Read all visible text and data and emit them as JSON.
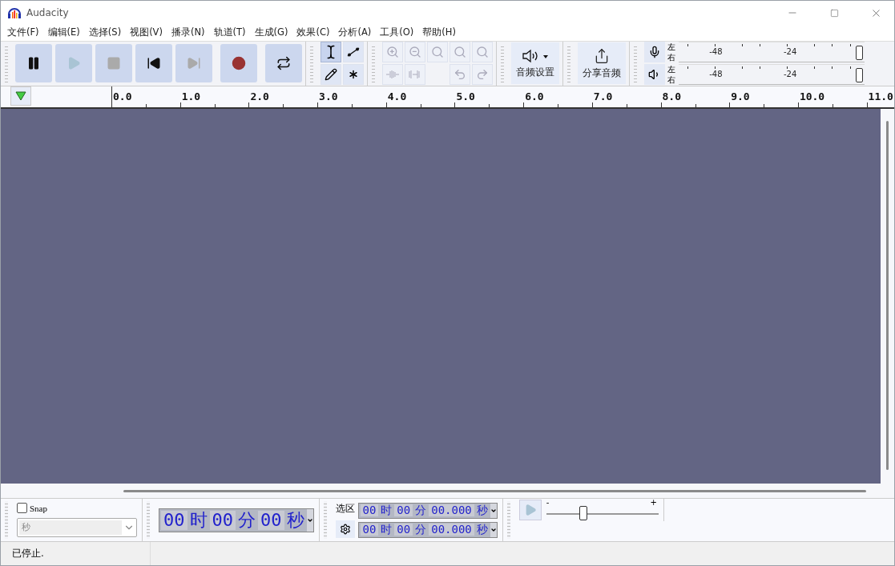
{
  "window": {
    "title": "Audacity"
  },
  "menu": [
    "文件(F)",
    "编辑(E)",
    "选择(S)",
    "视图(V)",
    "播录(N)",
    "轨道(T)",
    "生成(G)",
    "效果(C)",
    "分析(A)",
    "工具(O)",
    "帮助(H)"
  ],
  "transport": [
    {
      "kind": "pause",
      "disabled": false
    },
    {
      "kind": "play",
      "disabled": true
    },
    {
      "kind": "stop",
      "disabled": true
    },
    {
      "kind": "skip-start",
      "disabled": false
    },
    {
      "kind": "skip-end",
      "disabled": true
    },
    {
      "kind": "record",
      "disabled": false
    },
    {
      "kind": "loop",
      "disabled": false
    }
  ],
  "tools": [
    {
      "kind": "select",
      "selected": true
    },
    {
      "kind": "envelope",
      "selected": false
    },
    {
      "kind": "draw",
      "selected": false
    },
    {
      "kind": "multi",
      "selected": false
    }
  ],
  "edit_tools": [
    {
      "kind": "zoom-in",
      "disabled": true
    },
    {
      "kind": "zoom-out",
      "disabled": true
    },
    {
      "kind": "fit-selection",
      "disabled": true
    },
    {
      "kind": "fit-project",
      "disabled": true
    },
    {
      "kind": "zoom-toggle",
      "disabled": true
    },
    {
      "kind": "trim",
      "disabled": true
    },
    {
      "kind": "silence",
      "disabled": true
    },
    {
      "kind": "blank"
    },
    {
      "kind": "undo",
      "disabled": true
    },
    {
      "kind": "redo",
      "disabled": true
    }
  ],
  "audio_setup": {
    "label": "音频设置"
  },
  "share_audio": {
    "label": "分享音频"
  },
  "meters": [
    {
      "kind": "record",
      "channels": [
        "左",
        "右"
      ],
      "scale": [
        "-48",
        "-24"
      ],
      "level": 1
    },
    {
      "kind": "playback",
      "channels": [
        "左",
        "右"
      ],
      "scale": [
        "-48",
        "-24"
      ],
      "level": 1
    }
  ],
  "ruler": {
    "labels": [
      "0.0",
      "1.0",
      "2.0",
      "3.0",
      "4.0",
      "5.0",
      "6.0",
      "7.0",
      "8.0",
      "9.0",
      "10.0",
      "11.0"
    ]
  },
  "snap": {
    "label": "Snap",
    "checked": false,
    "unit": "秒",
    "disabled": true
  },
  "time": [
    "00",
    "时",
    "00",
    "分",
    "00",
    "秒"
  ],
  "selection": {
    "label": "选区",
    "start": [
      "00",
      "时",
      "00",
      "分",
      "00.000",
      "秒"
    ],
    "end": [
      "00",
      "时",
      "00",
      "分",
      "00.000",
      "秒"
    ]
  },
  "play_speed": {
    "minus": "-",
    "plus": "+",
    "level": 0.33
  },
  "status_bar": {
    "text": "已停止."
  }
}
